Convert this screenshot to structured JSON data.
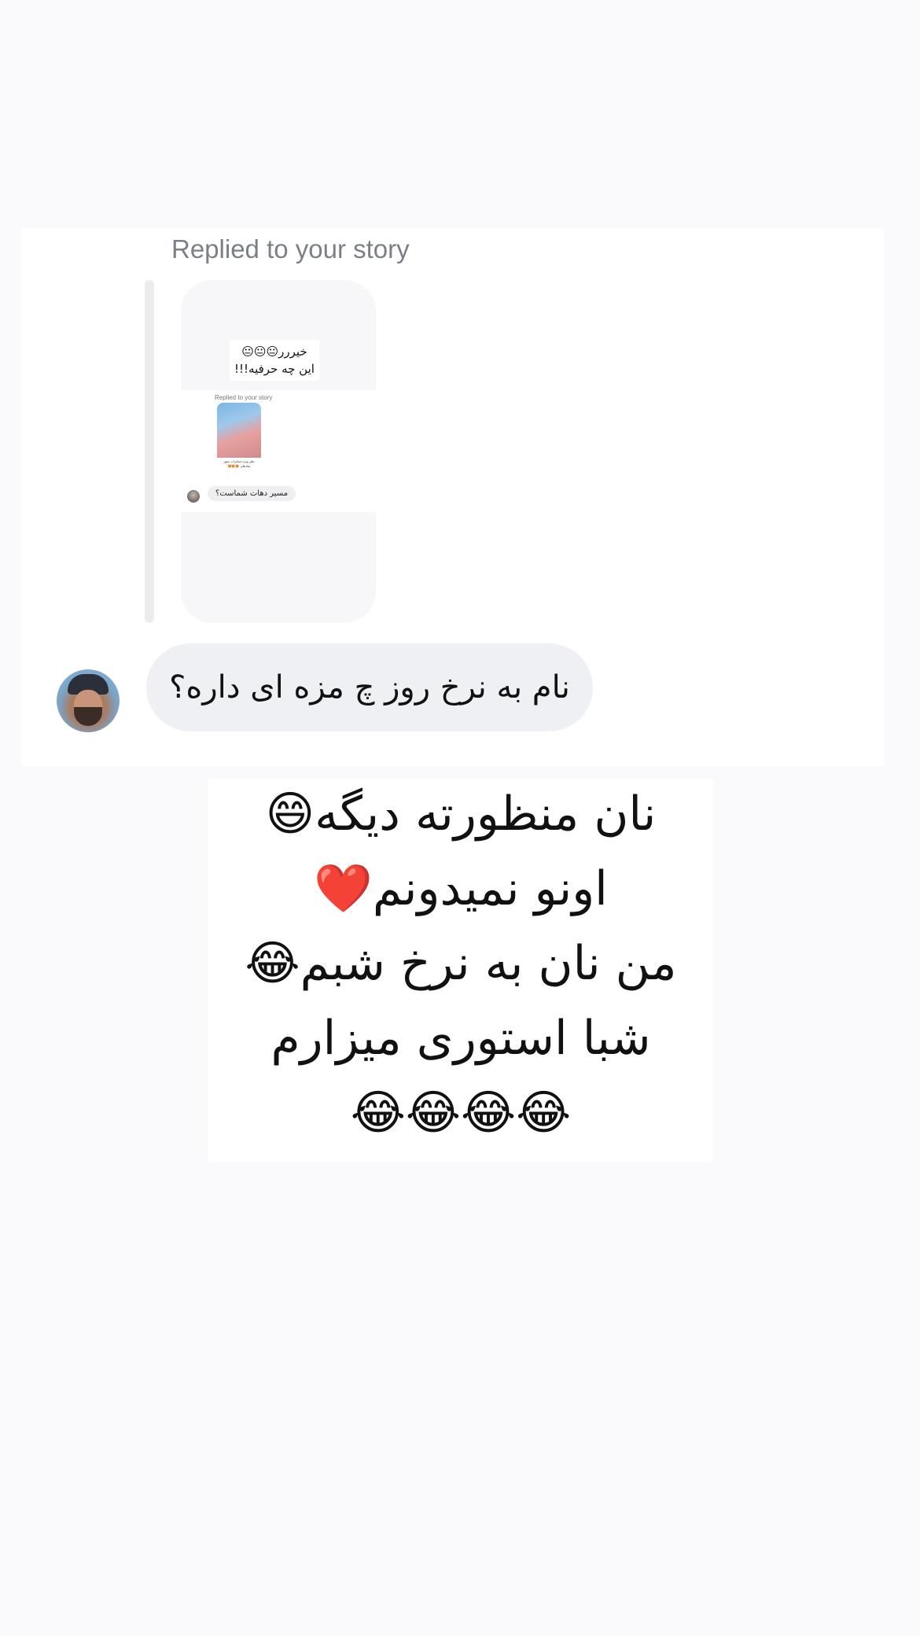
{
  "story_reply": {
    "label": "Replied to your story",
    "preview": {
      "caption_line1": "خیررر😐😐😐",
      "caption_line2": "این چه حرفیه!!!",
      "inner_label": "Replied to your story",
      "inner_thumb_text": "نظر ویژه مخابرات شهر نمادهای 🤩🤩🤩",
      "inner_reply": "مسیر دهات شماست؟"
    }
  },
  "message": {
    "text": "نام به نرخ روز چ مزه ای داره؟"
  },
  "sticker": {
    "lines": [
      "نان منظورته دیگه😄",
      "اونو نمیدونم❤️",
      "من نان به نرخ شبم😂",
      "شبا استوری میزارم",
      "😂😂😂😂"
    ]
  }
}
